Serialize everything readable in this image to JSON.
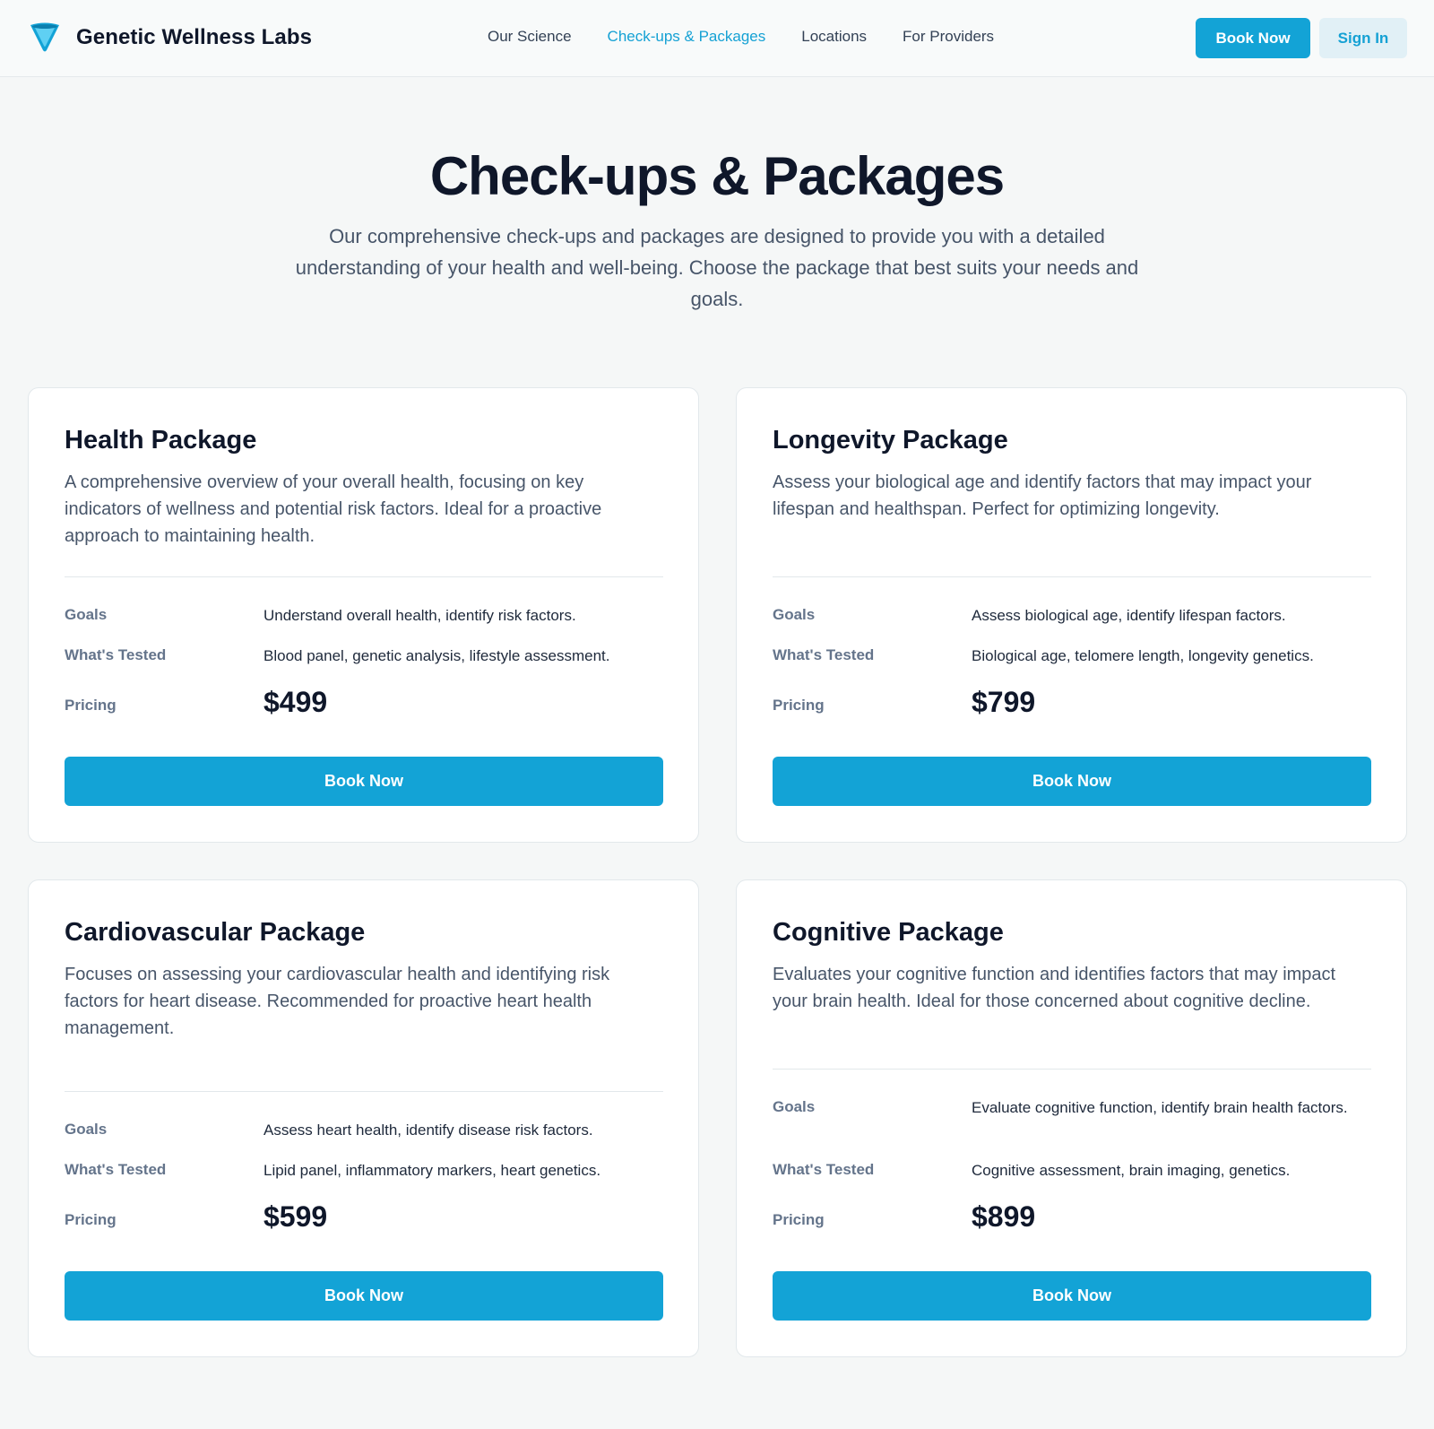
{
  "header": {
    "brand": "Genetic Wellness Labs",
    "nav": [
      "Our Science",
      "Check-ups & Packages",
      "Locations",
      "For Providers"
    ],
    "active_nav": "Check-ups & Packages",
    "book_label": "Book Now",
    "signin_label": "Sign In"
  },
  "hero": {
    "title": "Check-ups & Packages",
    "subtitle": "Our comprehensive check-ups and packages are designed to provide you with a detailed understanding of your health and well-being. Choose the package that best suits your needs and goals."
  },
  "labels": {
    "goals": "Goals",
    "tested": "What's Tested",
    "pricing": "Pricing",
    "book": "Book Now"
  },
  "packages": [
    {
      "title": "Health Package",
      "description": "A comprehensive overview of your overall health, focusing on key indicators of wellness and potential risk factors. Ideal for a proactive approach to maintaining health.",
      "goals": "Understand overall health, identify risk factors.",
      "tested": "Blood panel, genetic analysis, lifestyle assessment.",
      "price": "$499"
    },
    {
      "title": "Longevity Package",
      "description": "Assess your biological age and identify factors that may impact your lifespan and healthspan. Perfect for optimizing longevity.",
      "goals": "Assess biological age, identify lifespan factors.",
      "tested": "Biological age, telomere length, longevity genetics.",
      "price": "$799"
    },
    {
      "title": "Cardiovascular Package",
      "description": "Focuses on assessing your cardiovascular health and identifying risk factors for heart disease. Recommended for proactive heart health management.",
      "goals": "Assess heart health, identify disease risk factors.",
      "tested": "Lipid panel, inflammatory markers, heart genetics.",
      "price": "$599"
    },
    {
      "title": "Cognitive Package",
      "description": "Evaluates your cognitive function and identifies factors that may impact your brain health. Ideal for those concerned about cognitive decline.",
      "goals": "Evaluate cognitive function, identify brain health factors.",
      "tested": "Cognitive assessment, brain imaging, genetics.",
      "price": "$899"
    }
  ],
  "colors": {
    "accent": "#13a3d6",
    "accent_light": "#e1f0f6",
    "background": "#f5f7f7",
    "heading": "#0f172a",
    "body_text": "#475569"
  },
  "icons": {
    "logo": "funnel-logo-icon"
  }
}
